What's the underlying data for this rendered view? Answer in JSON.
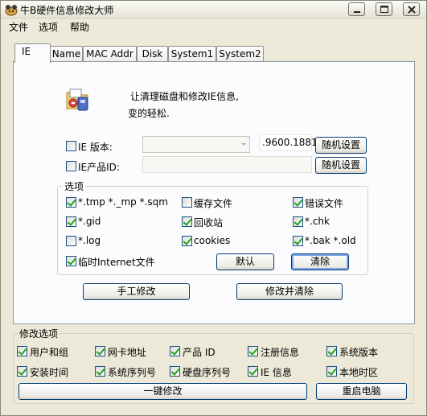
{
  "window": {
    "title": "牛B硬件信息修改大师"
  },
  "menu": [
    "文件",
    "选项",
    "帮助"
  ],
  "tabs": [
    "IE",
    "Name",
    "MAC Addr",
    "Disk",
    "System1",
    "System2"
  ],
  "ie_tab": {
    "intro_line1": "让清理磁盘和修改IE信息,",
    "intro_line2": "变的轻松.",
    "ie_version": {
      "label": "IE 版本:",
      "checked": false,
      "combo_value": "",
      "version_text": ".9600.1881",
      "random_button": "随机设置"
    },
    "ie_product_id": {
      "label": "IE产品ID:",
      "checked": false,
      "field_value": "",
      "random_button": "随机设置"
    },
    "options": {
      "title": "选项",
      "items": [
        {
          "label": "*.tmp  *._mp  *.sqm",
          "checked": true
        },
        {
          "label": "缓存文件",
          "checked": false
        },
        {
          "label": "错误文件",
          "checked": true
        },
        {
          "label": "*.gid",
          "checked": true
        },
        {
          "label": "回收站",
          "checked": true
        },
        {
          "label": "*.chk",
          "checked": true
        },
        {
          "label": "*.log",
          "checked": false
        },
        {
          "label": "cookies",
          "checked": true
        },
        {
          "label": "*.bak  *.old",
          "checked": true
        },
        {
          "label": "临时Internet文件",
          "checked": true
        }
      ],
      "default_button": "默认",
      "clear_button": "清除"
    },
    "manual_modify_button": "手工修改",
    "modify_and_clear_button": "修改并清除"
  },
  "modify_options": {
    "title": "修改选项",
    "items": [
      {
        "label": "用户和组",
        "checked": true
      },
      {
        "label": "网卡地址",
        "checked": true
      },
      {
        "label": "产品 ID",
        "checked": true
      },
      {
        "label": "注册信息",
        "checked": true
      },
      {
        "label": "系统版本",
        "checked": true
      },
      {
        "label": "安装时间",
        "checked": true
      },
      {
        "label": "系统序列号",
        "checked": true
      },
      {
        "label": "硬盘序列号",
        "checked": true
      },
      {
        "label": "IE 信息",
        "checked": true
      },
      {
        "label": "本地时区",
        "checked": true
      }
    ]
  },
  "one_click_button": "一键修改",
  "restart_button": "重启电脑",
  "icons": {
    "app": "cow-icon",
    "cleanup": "folder-cleanup-icon"
  }
}
